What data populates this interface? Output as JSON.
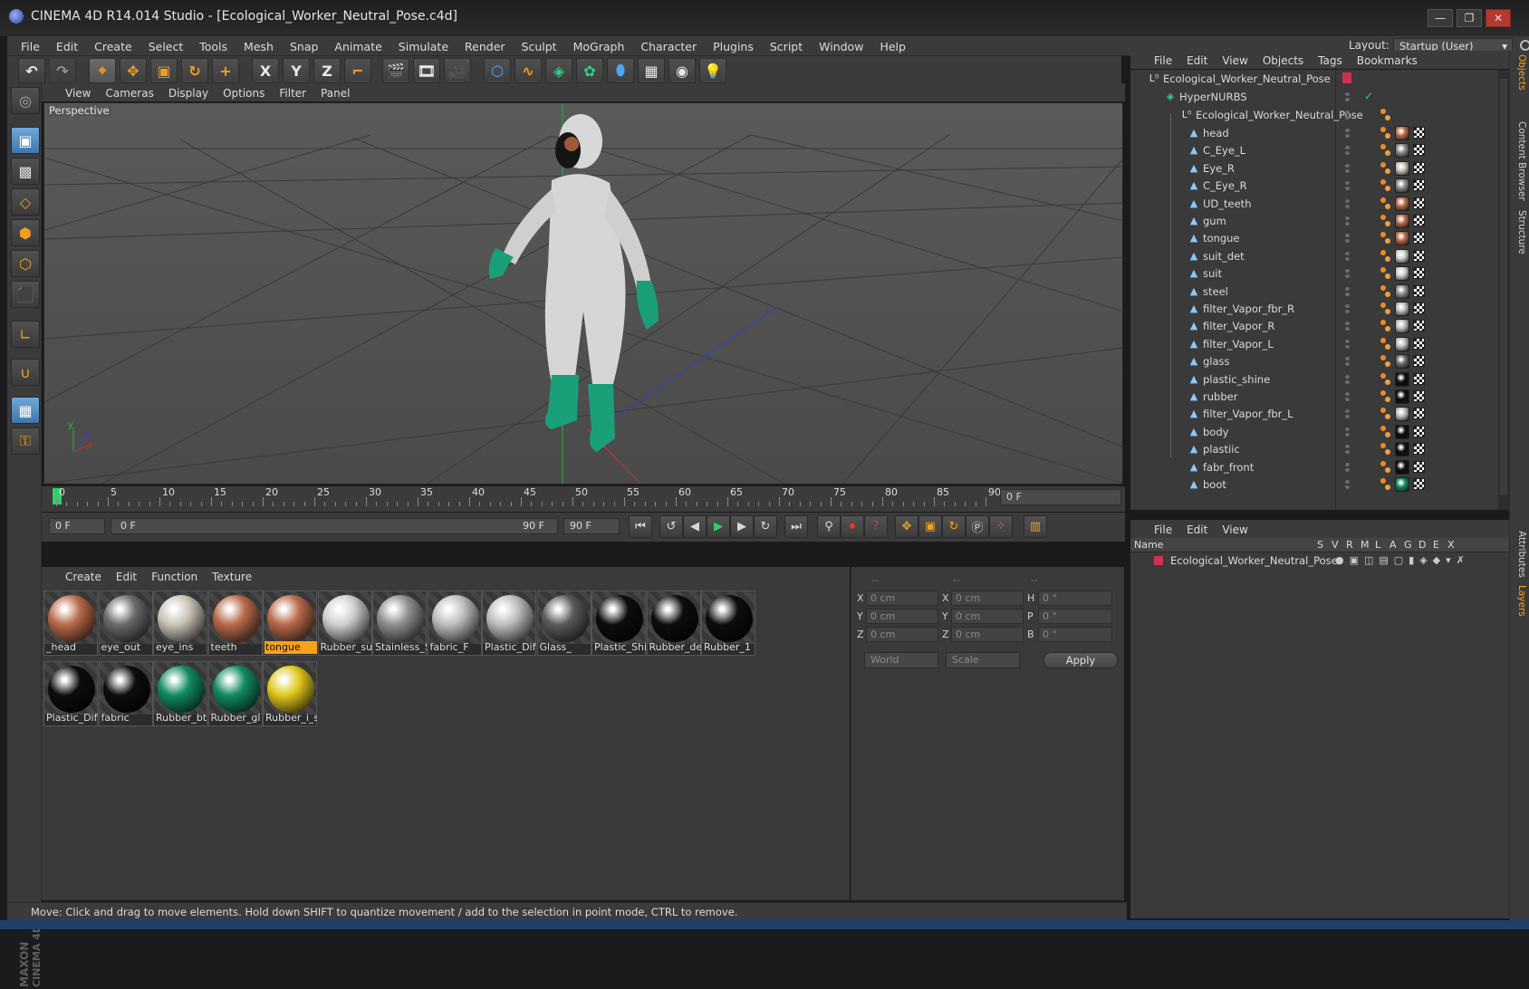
{
  "window": {
    "title": "CINEMA 4D R14.014 Studio - [Ecological_Worker_Neutral_Pose.c4d]",
    "buttons": {
      "minimize": "—",
      "restore": "❐",
      "close": "✕"
    }
  },
  "menubar": {
    "items": [
      "File",
      "Edit",
      "Create",
      "Select",
      "Tools",
      "Mesh",
      "Snap",
      "Animate",
      "Simulate",
      "Render",
      "Sculpt",
      "MoGraph",
      "Character",
      "Plugins",
      "Script",
      "Window",
      "Help"
    ],
    "layout_label": "Layout:",
    "layout_value": "Startup (User)"
  },
  "toolbar": {
    "axis_x": "X",
    "axis_y": "Y",
    "axis_z": "Z"
  },
  "viewport": {
    "menu": [
      "View",
      "Cameras",
      "Display",
      "Options",
      "Filter",
      "Panel"
    ],
    "label": "Perspective",
    "axes": {
      "x": "x",
      "y": "y",
      "z": "z"
    }
  },
  "timeline": {
    "ticks": [
      "0",
      "5",
      "10",
      "15",
      "20",
      "25",
      "30",
      "35",
      "40",
      "45",
      "50",
      "55",
      "60",
      "65",
      "70",
      "75",
      "80",
      "85",
      "90"
    ],
    "current_frame": "0 F"
  },
  "transport": {
    "start_field": "0 F",
    "range_start": "0 F",
    "range_end": "90 F",
    "end_field": "90 F"
  },
  "material_manager": {
    "menu": [
      "Create",
      "Edit",
      "Function",
      "Texture"
    ],
    "materials": [
      {
        "label": "_head",
        "color": "#b86a4a",
        "selected": false
      },
      {
        "label": "eye_out",
        "color": "#6a6a6a",
        "selected": false
      },
      {
        "label": "eye_ins",
        "color": "#c9c3b8",
        "selected": false
      },
      {
        "label": "teeth",
        "color": "#b86a4a",
        "selected": false
      },
      {
        "label": "tongue",
        "color": "#b86a4a",
        "selected": true
      },
      {
        "label": "Rubber_su",
        "color": "#cfcfcf",
        "selected": false
      },
      {
        "label": "Stainless_S",
        "color": "#8e8e8e",
        "selected": false
      },
      {
        "label": "fabric_F",
        "color": "#bdbdbd",
        "selected": false
      },
      {
        "label": "Plastic_Diff",
        "color": "#bdbdbd",
        "selected": false
      },
      {
        "label": "Glass_",
        "color": "#5a5a5a",
        "selected": false
      },
      {
        "label": "Plastic_Shir",
        "color": "#0d0d0d",
        "selected": false
      },
      {
        "label": "Rubber_de",
        "color": "#0d0d0d",
        "selected": false
      },
      {
        "label": "Rubber_1",
        "color": "#0d0d0d",
        "selected": false
      },
      {
        "label": "Plastic_Diff",
        "color": "#0d0d0d",
        "selected": false
      },
      {
        "label": "fabric",
        "color": "#0d0d0d",
        "selected": false
      },
      {
        "label": "Rubber_bt",
        "color": "#128a62",
        "selected": false
      },
      {
        "label": "Rubber_gl",
        "color": "#128a62",
        "selected": false
      },
      {
        "label": "Rubber_i_s",
        "color": "#e0c81c",
        "selected": false
      }
    ]
  },
  "coordinates": {
    "header": [
      "--",
      "--",
      "--"
    ],
    "rows": [
      {
        "l1": "X",
        "v1": "0 cm",
        "l2": "X",
        "v2": "0 cm",
        "l3": "H",
        "v3": "0 °"
      },
      {
        "l1": "Y",
        "v1": "0 cm",
        "l2": "Y",
        "v2": "0 cm",
        "l3": "P",
        "v3": "0 °"
      },
      {
        "l1": "Z",
        "v1": "0 cm",
        "l2": "Z",
        "v2": "0 cm",
        "l3": "B",
        "v3": "0 °"
      }
    ],
    "world": "World",
    "scale": "Scale",
    "apply": "Apply"
  },
  "status": {
    "text": "Move: Click and drag to move elements. Hold down SHIFT to quantize movement / add to the selection in point mode, CTRL to remove."
  },
  "object_manager": {
    "menu": [
      "File",
      "Edit",
      "View",
      "Objects",
      "Tags",
      "Bookmarks"
    ],
    "root": "Ecological_Worker_Neutral_Pose",
    "hypernurbs": "HyperNURBS",
    "group": "Ecological_Worker_Neutral_Pose",
    "objects": [
      {
        "name": "head",
        "mat": "#b86a4a"
      },
      {
        "name": "C_Eye_L",
        "mat": "#8a8a8a"
      },
      {
        "name": "Eye_R",
        "mat": "#c9c3b8"
      },
      {
        "name": "C_Eye_R",
        "mat": "#8a8a8a"
      },
      {
        "name": "UD_teeth",
        "mat": "#b86a4a"
      },
      {
        "name": "gum",
        "mat": "#b86a4a"
      },
      {
        "name": "tongue",
        "mat": "#b86a4a"
      },
      {
        "name": "suit_det",
        "mat": "#cfcfcf"
      },
      {
        "name": "suit",
        "mat": "#cfcfcf"
      },
      {
        "name": "steel",
        "mat": "#8e8e8e"
      },
      {
        "name": "filter_Vapor_fbr_R",
        "mat": "#bdbdbd"
      },
      {
        "name": "filter_Vapor_R",
        "mat": "#bdbdbd"
      },
      {
        "name": "filter_Vapor_L",
        "mat": "#bdbdbd"
      },
      {
        "name": "glass",
        "mat": "#6a6a6a"
      },
      {
        "name": "plastic_shine",
        "mat": "#0d0d0d"
      },
      {
        "name": "rubber",
        "mat": "#0d0d0d"
      },
      {
        "name": "filter_Vapor_fbr_L",
        "mat": "#bdbdbd"
      },
      {
        "name": "body",
        "mat": "#0d0d0d"
      },
      {
        "name": "plastiic",
        "mat": "#0d0d0d"
      },
      {
        "name": "fabr_front",
        "mat": "#0d0d0d"
      },
      {
        "name": "boot",
        "mat": "#128a62"
      }
    ]
  },
  "layer_manager": {
    "menu": [
      "File",
      "Edit",
      "View"
    ],
    "columns": [
      "Name",
      "S",
      "V",
      "R",
      "M",
      "L",
      "A",
      "G",
      "D",
      "E",
      "X"
    ],
    "layer_name": "Ecological_Worker_Neutral_Pose"
  },
  "side_tabs": [
    "Objects",
    "Content Browser",
    "Structure",
    "Attributes",
    "Layers"
  ],
  "brand": {
    "maxon": "MAXON",
    "cinema": "CINEMA 4D"
  }
}
